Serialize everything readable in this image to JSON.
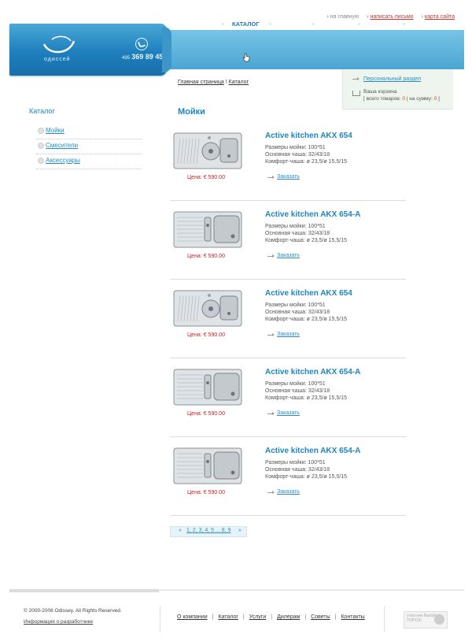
{
  "top_links": {
    "home": "на главную",
    "write": "написать письмо",
    "sitemap": "карта сайта"
  },
  "header": {
    "logo_text": "одиссей",
    "phone_code": "495",
    "phone_number": "369 89 45"
  },
  "nav": {
    "items": [
      "О КОМПАНИИ",
      "КАТАЛОГ",
      "УСЛУГИ",
      "ДИЛЕРАМ",
      "СОВЕТЫ",
      "КОНТАКТЫ"
    ],
    "active": "КАТАЛОГ"
  },
  "cart": {
    "personal_link": "Персональный раздел",
    "title": "Ваша корзина",
    "items_prefix": "[ всего товаров: ",
    "items_count": "0",
    "sum_prefix": " | на сумму: ",
    "sum_value": "0",
    "suffix": " ]"
  },
  "breadcrumb": {
    "home": "Главная страница",
    "sep": "\\",
    "current": "Каталог"
  },
  "sidebar": {
    "title": "Каталог",
    "items": [
      {
        "label": "Мойки"
      },
      {
        "label": "Смесители"
      },
      {
        "label": "Аксессуары"
      }
    ]
  },
  "main": {
    "title": "Мойки",
    "order_label": "Заказать",
    "products": [
      {
        "name": "Active kitchen AKX 654",
        "size": "Размеры мойки: 100*51",
        "bowl": "Основная чаша: 32/43/18",
        "comfort": "Комфорт-чаша: ø 23,5/ø 15,5/15",
        "price": "Цена: € 590.00",
        "variant": "round"
      },
      {
        "name": "Active kitchen AKX 654-A",
        "size": "Размеры мойки: 100*51",
        "bowl": "Основная чаша: 32/43/18",
        "comfort": "Комфорт-чаша: ø 23,5/ø 15,5/15",
        "price": "Цена: € 590.00",
        "variant": "square"
      },
      {
        "name": "Active kitchen AKX 654",
        "size": "Размеры мойки: 100*51",
        "bowl": "Основная чаша: 32/43/18",
        "comfort": "Комфорт-чаша: ø 23,5/ø 15,5/15",
        "price": "Цена: € 590.00",
        "variant": "round"
      },
      {
        "name": "Active kitchen AKX 654-A",
        "size": "Размеры мойки: 100*51",
        "bowl": "Основная чаша: 32/43/18",
        "comfort": "Комфорт-чаша: ø 23,5/ø 15,5/15",
        "price": "Цена: € 590.00",
        "variant": "square"
      },
      {
        "name": "Active kitchen AKX 654-A",
        "size": "Размеры мойки: 100*51",
        "bowl": "Основная чаша: 32/43/18",
        "comfort": "Комфорт-чаша: ø 23,5/ø 15,5/15",
        "price": "Цена: € 590.00",
        "variant": "square"
      }
    ]
  },
  "pager": {
    "prev": "«",
    "pages": "1, 2, 3, 4, 5 ... 8, 9",
    "next": "»"
  },
  "footer": {
    "copyright": "© 2000-2006 Odissey. All Rights Reserved.",
    "developer": "Информация о разработчике",
    "links": [
      "О компании",
      "Каталог",
      "Услуги",
      "Дилерам",
      "Советы",
      "Контакты"
    ],
    "badge_text": "участник Rambler's TOP100"
  },
  "colors": {
    "accent": "#1d86bf",
    "header_blue": "#4aa6d3",
    "price_red": "#cc2222",
    "cart_bg": "#eef5ee"
  }
}
